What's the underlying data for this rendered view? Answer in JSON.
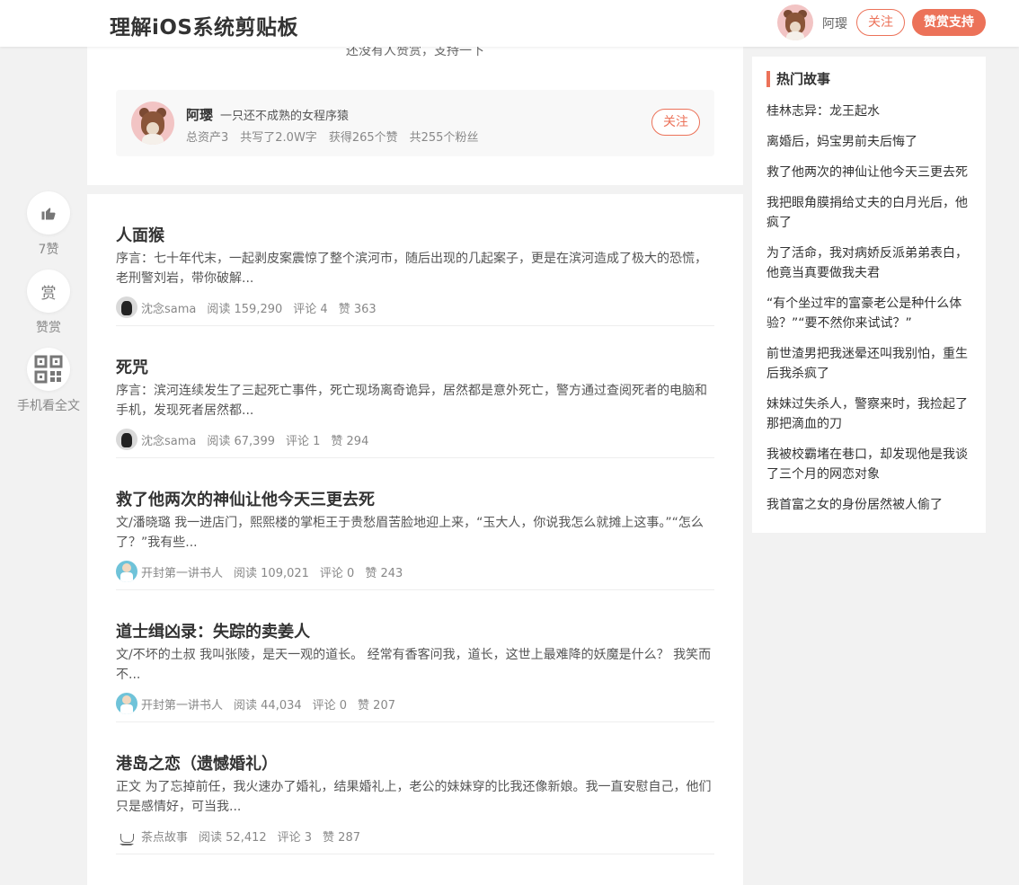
{
  "header": {
    "title": "理解iOS系统剪贴板",
    "author_name": "阿璎",
    "follow_label": "关注",
    "reward_label": "赞赏支持"
  },
  "side_actions": {
    "like_label": "7赞",
    "reward_glyph": "赏",
    "reward_label": "赞赏",
    "mobile_label": "手机看全文"
  },
  "reward_section": {
    "empty_text": "还没有人赞赏，支持一下"
  },
  "author_card": {
    "name": "阿璎",
    "bio": "一只还不成熟的女程序猿",
    "stats": [
      "总资产3",
      "共写了2.0W字",
      "获得265个赞",
      "共255个粉丝"
    ],
    "follow_label": "关注"
  },
  "articles": [
    {
      "title": "人面猴",
      "excerpt": "序言：七十年代末，一起剥皮案震惊了整个滨河市，随后出现的几起案子，更是在滨河造成了极大的恐慌，老刑警刘岩，带你破解...",
      "author": "沈念sama",
      "reads": "阅读 159,290",
      "comments": "评论 4",
      "likes": "赞 363",
      "avatar": "cat"
    },
    {
      "title": "死咒",
      "excerpt": "序言：滨河连续发生了三起死亡事件，死亡现场离奇诡异，居然都是意外死亡，警方通过查阅死者的电脑和手机，发现死者居然都...",
      "author": "沈念sama",
      "reads": "阅读 67,399",
      "comments": "评论 1",
      "likes": "赞 294",
      "avatar": "cat"
    },
    {
      "title": "救了他两次的神仙让他今天三更去死",
      "excerpt": "文/潘晓璐 我一进店门，熙熙楼的掌柜王于贵愁眉苦脸地迎上来，“玉大人，你说我怎么就摊上这事。”“怎么了？”我有些...",
      "author": "开封第一讲书人",
      "reads": "阅读 109,021",
      "comments": "评论 0",
      "likes": "赞 243",
      "avatar": "man"
    },
    {
      "title": "道士缉凶录：失踪的卖姜人",
      "excerpt": "文/不坏的土叔 我叫张陵，是天一观的道长。 经常有香客问我，道长，这世上最难降的妖魔是什么？ 我笑而不...",
      "author": "开封第一讲书人",
      "reads": "阅读 44,034",
      "comments": "评论 0",
      "likes": "赞 207",
      "avatar": "man"
    },
    {
      "title": "港岛之恋（遗憾婚礼）",
      "excerpt": "正文 为了忘掉前任，我火速办了婚礼，结果婚礼上，老公的妹妹穿的比我还像新娘。我一直安慰自己，他们只是感情好，可当我...",
      "author": "茶点故事",
      "reads": "阅读 52,412",
      "comments": "评论 3",
      "likes": "赞 287",
      "avatar": "tea"
    }
  ],
  "hot_stories": {
    "heading": "热门故事",
    "items": [
      "桂林志异：龙王起水",
      "离婚后，妈宝男前夫后悔了",
      "救了他两次的神仙让他今天三更去死",
      "我把眼角膜捐给丈夫的白月光后，他疯了",
      "为了活命，我对病娇反派弟弟表白，他竟当真要做我夫君",
      "“有个坐过牢的富豪老公是种什么体验？”“要不然你来试试？”",
      "前世渣男把我迷晕还叫我别怕，重生后我杀疯了",
      "妹妹过失杀人，警察来时，我捡起了那把滴血的刀",
      "我被校霸堵在巷口，却发现他是我谈了三个月的网恋对象",
      "我首富之女的身份居然被人偷了"
    ]
  },
  "colors": {
    "accent": "#ec7259",
    "background": "#f2f2f2"
  }
}
